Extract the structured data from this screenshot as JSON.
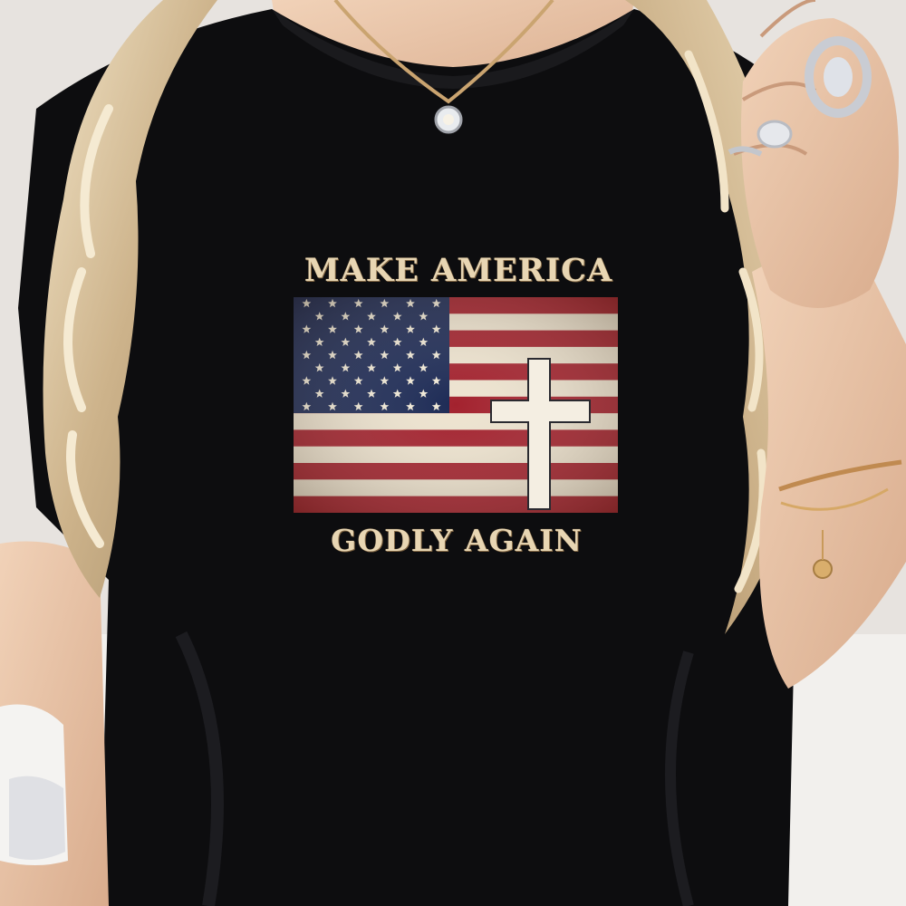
{
  "scene": {
    "description_alt": "Woman wearing a black t-shirt with a flag and cross print",
    "colors": {
      "shirt": "#0d0d0f",
      "skin": "#e8c3a6",
      "hair": "#d9c3a0",
      "print_text": "#e8d6b3",
      "flag_red": "#a3222e",
      "flag_white": "#ede3cf",
      "flag_blue": "#1c2a55",
      "cross": "#f4eee2"
    }
  },
  "print": {
    "headline": "MAKE AMERICA",
    "subline": "GODLY AGAIN"
  },
  "icons": {
    "flag": "american-flag-icon",
    "cross": "cross-icon",
    "necklace": "necklace-icon",
    "rings": "ring-icon",
    "bracelet": "bracelet-icon"
  }
}
